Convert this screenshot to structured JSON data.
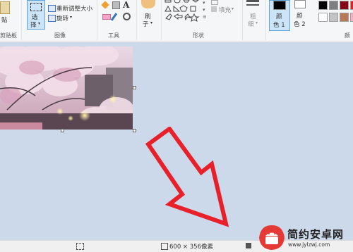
{
  "ribbon": {
    "clipboard": {
      "paste_label": "贴",
      "group_label": "剪贴板"
    },
    "image": {
      "select_label": "选",
      "select_label2": "择",
      "resize_label": "重新调整大小",
      "rotate_label": "旋转",
      "group_label": "图像"
    },
    "tools": {
      "group_label": "工具"
    },
    "brushes": {
      "label": "刷",
      "label2": "子"
    },
    "shapes": {
      "fill_label": "填充",
      "group_label": "形状"
    },
    "size": {
      "label": "粗",
      "label2": "细"
    },
    "colors": {
      "color1_label": "颜",
      "color1_label2": "色 1",
      "color2_label": "颜",
      "color2_label2": "色 2",
      "group_label": "颜",
      "color1_value": "#000000",
      "color2_value": "#ffffff",
      "palette": [
        "#000000",
        "#7f7f7f",
        "#880015",
        "#ed1c24",
        "#ffffff",
        "#c3c3c3",
        "#b97a57",
        "#ffaec9"
      ]
    }
  },
  "status": {
    "image_size": "600 × 356像素"
  },
  "watermark": {
    "title": "简约安卓网",
    "url": "www.jylzwj.com"
  }
}
